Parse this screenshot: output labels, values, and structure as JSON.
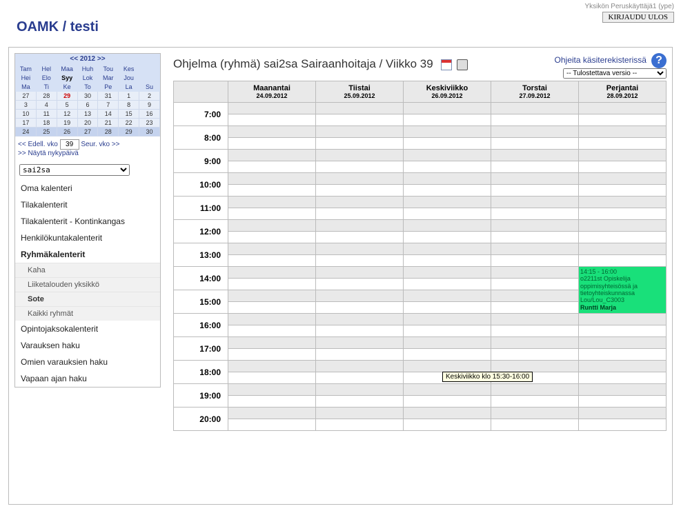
{
  "user_label": "Yksikön Peruskäyttäjä1 (ype)",
  "logout": "KIRJAUDU ULOS",
  "brand": "OAMK / testi",
  "minical": {
    "year_prev": "<<",
    "year": "2012",
    "year_next": ">>",
    "months1": [
      "Tam",
      "Hel",
      "Maa",
      "Huh",
      "Tou",
      "Kes"
    ],
    "months2": [
      "Hei",
      "Elo",
      "Syy",
      "Lok",
      "Mar",
      "Jou"
    ],
    "current_month_index": 2,
    "dow": [
      "Ma",
      "Ti",
      "Ke",
      "To",
      "Pe",
      "La",
      "Su"
    ],
    "weeks": [
      [
        "27",
        "28",
        "29",
        "30",
        "31",
        "1",
        "2"
      ],
      [
        "3",
        "4",
        "5",
        "6",
        "7",
        "8",
        "9"
      ],
      [
        "10",
        "11",
        "12",
        "13",
        "14",
        "15",
        "16"
      ],
      [
        "17",
        "18",
        "19",
        "20",
        "21",
        "22",
        "23"
      ],
      [
        "24",
        "25",
        "26",
        "27",
        "28",
        "29",
        "30"
      ]
    ],
    "today": "29",
    "sel_row": 4
  },
  "weeknav": {
    "prev": "<< Edell. vko",
    "week": "39",
    "next": "Seur. vko >>",
    "today": ">> Näytä nykypäivä"
  },
  "group_select": "sai2sa",
  "nav": {
    "i0": "Oma kalenteri",
    "i1": "Tilakalenterit",
    "i2": "Tilakalenterit - Kontinkangas",
    "i3": "Henkilökuntakalenterit",
    "i4": "Ryhmäkalenterit",
    "s0": "Kaha",
    "s1": "Liiketalouden yksikkö",
    "s2": "Sote",
    "s3": "Kaikki ryhmät",
    "i5": "Opintojaksokalenterit",
    "i6": "Varauksen haku",
    "i7": "Omien varauksien haku",
    "i8": "Vapaan ajan haku"
  },
  "main": {
    "title": "Ohjelma (ryhmä) sai2sa Sairaanhoitaja / Viikko 39",
    "help_link": "Ohjeita käsiterekisterissä",
    "print_select": "-- Tulostettava versio --",
    "days": [
      {
        "name": "Maanantai",
        "date": "24.09.2012"
      },
      {
        "name": "Tiistai",
        "date": "25.09.2012"
      },
      {
        "name": "Keskiviikko",
        "date": "26.09.2012"
      },
      {
        "name": "Torstai",
        "date": "27.09.2012"
      },
      {
        "name": "Perjantai",
        "date": "28.09.2012"
      }
    ],
    "hours": [
      "7:00",
      "8:00",
      "9:00",
      "10:00",
      "11:00",
      "12:00",
      "13:00",
      "14:00",
      "15:00",
      "16:00",
      "17:00",
      "18:00",
      "19:00",
      "20:00"
    ]
  },
  "event": {
    "time": "14:15 - 16:00",
    "l1": "o2211st Opiskelija",
    "l2": "oppimisyhteisössä ja",
    "l3": "tietoyhteiskunnassa",
    "l4": "Lou/Lou_C3003",
    "teacher": "Runtti Marja"
  },
  "tooltip": "Keskiviikko klo 15:30-16:00"
}
